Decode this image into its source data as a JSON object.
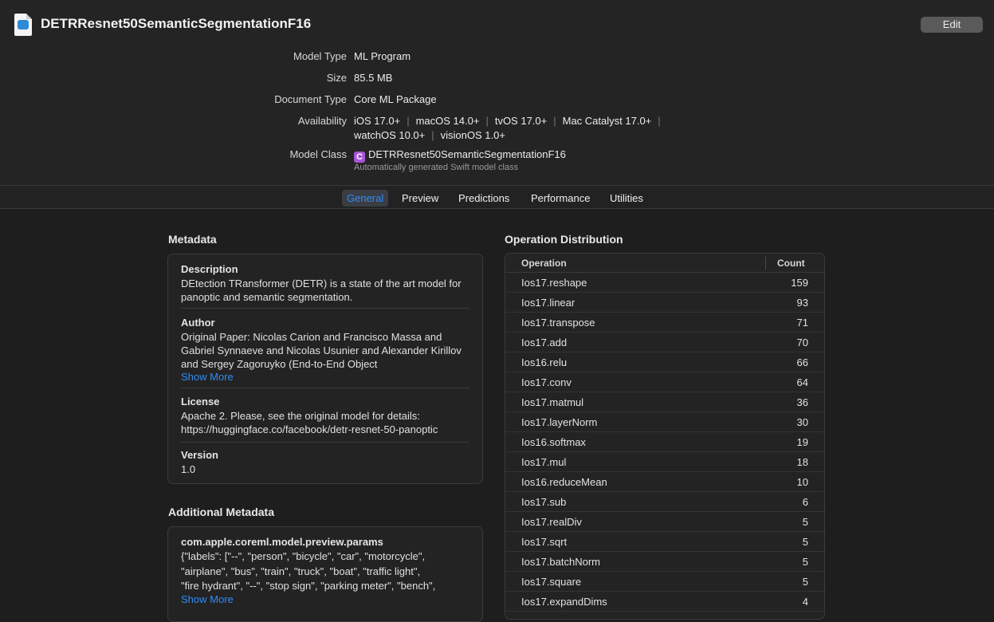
{
  "header": {
    "title": "DETRResnet50SemanticSegmentationF16",
    "edit_label": "Edit",
    "file_icon": "mlpackage-file-icon"
  },
  "properties": {
    "model_type": {
      "label": "Model Type",
      "value": "ML Program"
    },
    "size": {
      "label": "Size",
      "value": "85.5 MB"
    },
    "document_type": {
      "label": "Document Type",
      "value": "Core ML Package"
    },
    "availability": {
      "label": "Availability",
      "line1": [
        "iOS 17.0+",
        "macOS 14.0+",
        "tvOS 17.0+",
        "Mac Catalyst 17.0+"
      ],
      "line2": [
        "watchOS 10.0+",
        "visionOS 1.0+"
      ]
    },
    "model_class": {
      "label": "Model Class",
      "badge": "C",
      "value": "DETRResnet50SemanticSegmentationF16",
      "note": "Automatically generated Swift model class"
    }
  },
  "tabs": [
    {
      "label": "General",
      "active": true
    },
    {
      "label": "Preview",
      "active": false
    },
    {
      "label": "Predictions",
      "active": false
    },
    {
      "label": "Performance",
      "active": false
    },
    {
      "label": "Utilities",
      "active": false
    }
  ],
  "metadata": {
    "title": "Metadata",
    "description": {
      "label": "Description",
      "text": "DEtection TRansformer (DETR) is a state of the art model for panoptic and semantic segmentation."
    },
    "author": {
      "label": "Author",
      "text": "Original Paper: Nicolas Carion and Francisco Massa and Gabriel Synnaeve and Nicolas Usunier and Alexander Kirillov and Sergey Zagoruyko (End-to-End Object",
      "show_more": "Show More"
    },
    "license": {
      "label": "License",
      "line1": "Apache 2. Please, see the original model for details:",
      "line2": "https://huggingface.co/facebook/detr-resnet-50-panoptic"
    },
    "version": {
      "label": "Version",
      "value": "1.0"
    }
  },
  "additional_metadata": {
    "title": "Additional Metadata",
    "key": "com.apple.coreml.model.preview.params",
    "line1": "{\"labels\": [\"--\", \"person\", \"bicycle\", \"car\", \"motorcycle\",",
    "line2": "\"airplane\", \"bus\", \"train\", \"truck\", \"boat\", \"traffic light\",",
    "line3": "\"fire hydrant\", \"--\", \"stop sign\", \"parking meter\", \"bench\",",
    "show_more": "Show More"
  },
  "operations": {
    "title": "Operation Distribution",
    "col_operation": "Operation",
    "col_count": "Count",
    "rows": [
      {
        "op": "Ios17.reshape",
        "count": "159"
      },
      {
        "op": "Ios17.linear",
        "count": "93"
      },
      {
        "op": "Ios17.transpose",
        "count": "71"
      },
      {
        "op": "Ios17.add",
        "count": "70"
      },
      {
        "op": "Ios16.relu",
        "count": "66"
      },
      {
        "op": "Ios17.conv",
        "count": "64"
      },
      {
        "op": "Ios17.matmul",
        "count": "36"
      },
      {
        "op": "Ios17.layerNorm",
        "count": "30"
      },
      {
        "op": "Ios16.softmax",
        "count": "19"
      },
      {
        "op": "Ios17.mul",
        "count": "18"
      },
      {
        "op": "Ios16.reduceMean",
        "count": "10"
      },
      {
        "op": "Ios17.sub",
        "count": "6"
      },
      {
        "op": "Ios17.realDiv",
        "count": "5"
      },
      {
        "op": "Ios17.sqrt",
        "count": "5"
      },
      {
        "op": "Ios17.batchNorm",
        "count": "5"
      },
      {
        "op": "Ios17.square",
        "count": "5"
      },
      {
        "op": "Ios17.expandDims",
        "count": "4"
      }
    ]
  }
}
